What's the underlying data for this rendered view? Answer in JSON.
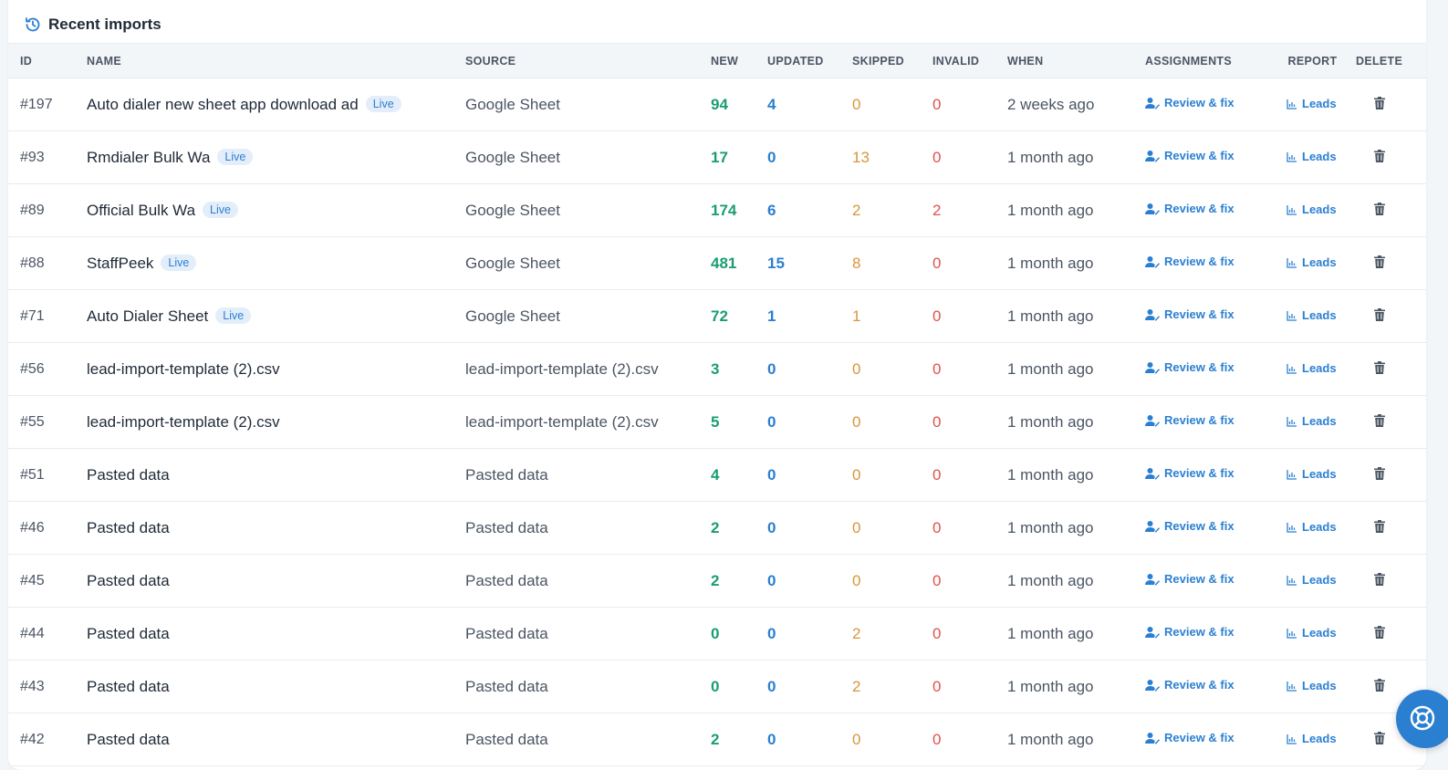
{
  "card": {
    "title": "Recent imports",
    "header_icon": "history-icon"
  },
  "columns": {
    "id": "ID",
    "name": "NAME",
    "source": "SOURCE",
    "new": "NEW",
    "updated": "UPDATED",
    "skipped": "SKIPPED",
    "invalid": "INVALID",
    "when": "WHEN",
    "assignments": "ASSIGNMENTS",
    "report": "REPORT",
    "delete": "DELETE"
  },
  "labels": {
    "live": "Live",
    "review": "Review & fix",
    "leads": "Leads"
  },
  "colors": {
    "accent": "#2b7fd1",
    "new": "#1a9e6f",
    "skipped": "#d9953a",
    "invalid": "#e0524a"
  },
  "rows": [
    {
      "id": "#197",
      "name": "Auto dialer new sheet app download ad",
      "live": true,
      "source": "Google Sheet",
      "new": "94",
      "updated": "4",
      "skipped": "0",
      "invalid": "0",
      "when": "2 weeks ago"
    },
    {
      "id": "#93",
      "name": "Rmdialer Bulk Wa",
      "live": true,
      "source": "Google Sheet",
      "new": "17",
      "updated": "0",
      "skipped": "13",
      "invalid": "0",
      "when": "1 month ago"
    },
    {
      "id": "#89",
      "name": "Official Bulk Wa",
      "live": true,
      "source": "Google Sheet",
      "new": "174",
      "updated": "6",
      "skipped": "2",
      "invalid": "2",
      "when": "1 month ago"
    },
    {
      "id": "#88",
      "name": "StaffPeek",
      "live": true,
      "source": "Google Sheet",
      "new": "481",
      "updated": "15",
      "skipped": "8",
      "invalid": "0",
      "when": "1 month ago"
    },
    {
      "id": "#71",
      "name": "Auto Dialer Sheet",
      "live": true,
      "source": "Google Sheet",
      "new": "72",
      "updated": "1",
      "skipped": "1",
      "invalid": "0",
      "when": "1 month ago"
    },
    {
      "id": "#56",
      "name": "lead-import-template (2).csv",
      "live": false,
      "source": "lead-import-template (2).csv",
      "new": "3",
      "updated": "0",
      "skipped": "0",
      "invalid": "0",
      "when": "1 month ago"
    },
    {
      "id": "#55",
      "name": "lead-import-template (2).csv",
      "live": false,
      "source": "lead-import-template (2).csv",
      "new": "5",
      "updated": "0",
      "skipped": "0",
      "invalid": "0",
      "when": "1 month ago"
    },
    {
      "id": "#51",
      "name": "Pasted data",
      "live": false,
      "source": "Pasted data",
      "new": "4",
      "updated": "0",
      "skipped": "0",
      "invalid": "0",
      "when": "1 month ago"
    },
    {
      "id": "#46",
      "name": "Pasted data",
      "live": false,
      "source": "Pasted data",
      "new": "2",
      "updated": "0",
      "skipped": "0",
      "invalid": "0",
      "when": "1 month ago"
    },
    {
      "id": "#45",
      "name": "Pasted data",
      "live": false,
      "source": "Pasted data",
      "new": "2",
      "updated": "0",
      "skipped": "0",
      "invalid": "0",
      "when": "1 month ago"
    },
    {
      "id": "#44",
      "name": "Pasted data",
      "live": false,
      "source": "Pasted data",
      "new": "0",
      "updated": "0",
      "skipped": "2",
      "invalid": "0",
      "when": "1 month ago"
    },
    {
      "id": "#43",
      "name": "Pasted data",
      "live": false,
      "source": "Pasted data",
      "new": "0",
      "updated": "0",
      "skipped": "2",
      "invalid": "0",
      "when": "1 month ago"
    },
    {
      "id": "#42",
      "name": "Pasted data",
      "live": false,
      "source": "Pasted data",
      "new": "2",
      "updated": "0",
      "skipped": "0",
      "invalid": "0",
      "when": "1 month ago"
    }
  ],
  "help_fab_icon": "lifebuoy-icon"
}
